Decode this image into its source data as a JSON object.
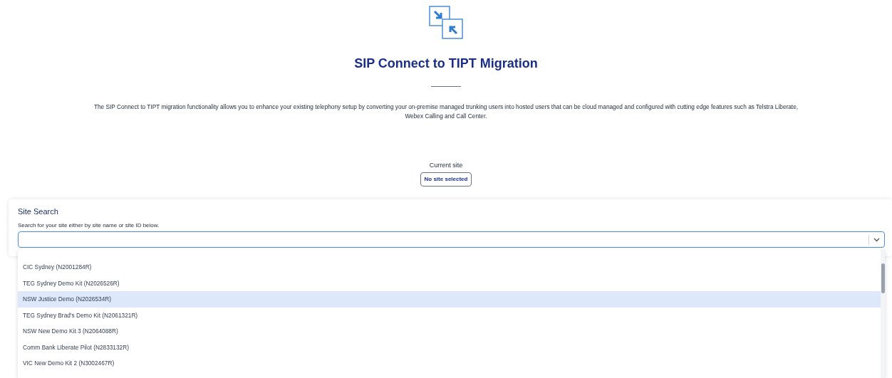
{
  "header": {
    "title": "SIP Connect to TIPT Migration",
    "description": "The SIP Connect to TIPT migration functionality allows you to enhance your existing telephony setup by converting your on-premise managed trunking users into hosted users that can be cloud managed and configured with cutting edge features such as Telstra Liberate, Webex Calling and Call Center."
  },
  "current_site": {
    "label": "Current site",
    "value": "No site selected"
  },
  "site_search": {
    "title": "Site Search",
    "hint": "Search for your site either by site name or site ID below.",
    "options": [
      {
        "label": "CIC Sydney (N2001284R)",
        "selected": false
      },
      {
        "label": "TEG Sydney Demo Kit (N2026526R)",
        "selected": false
      },
      {
        "label": "NSW Justice Demo (N2026534R)",
        "selected": true
      },
      {
        "label": "TEG Sydney Brad's Demo Kit (N2061321R)",
        "selected": false
      },
      {
        "label": "NSW New Demo Kit 3 (N2064088R)",
        "selected": false
      },
      {
        "label": "Comm Bank LIberate Pilot (N2833132R)",
        "selected": false
      },
      {
        "label": "VIC New Demo Kit 2 (N3002467R)",
        "selected": false
      }
    ]
  }
}
